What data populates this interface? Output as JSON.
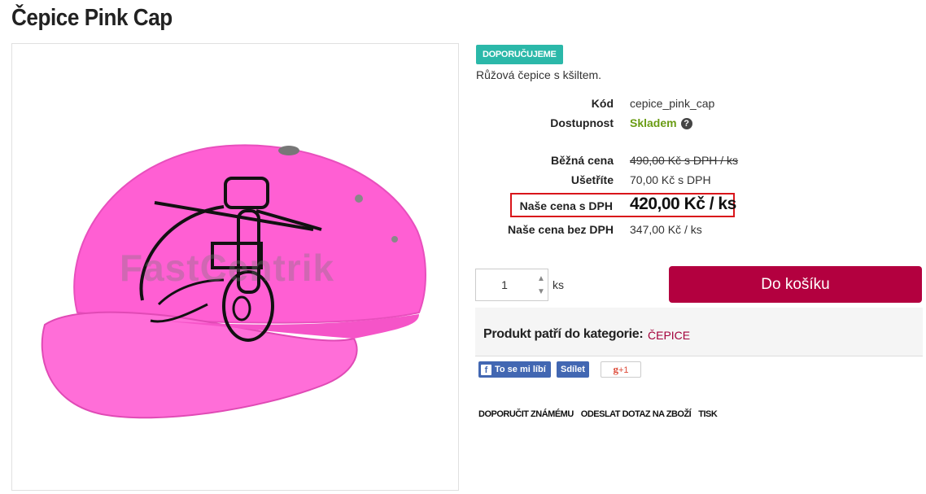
{
  "product": {
    "title": "Čepice Pink Cap",
    "badge": "DOPORUČUJEME",
    "short_description": "Růžová čepice s kšiltem.",
    "watermark": "FastCentrik",
    "image_icon": "pink-baseball-cap-image"
  },
  "details": {
    "code_label": "Kód",
    "code_value": "cepice_pink_cap",
    "availability_label": "Dostupnost",
    "availability_value": "Skladem",
    "availability_help_icon": "question-circle-icon",
    "regular_price_label": "Běžná cena",
    "regular_price_value": "490,00 Kč s DPH / ks",
    "savings_label": "Ušetříte",
    "savings_value": "70,00 Kč s DPH",
    "our_price_label": "Naše cena s DPH",
    "our_price_value": "420,00 Kč / ks",
    "price_no_vat_label": "Naše cena bez DPH",
    "price_no_vat_value": "347,00 Kč / ks"
  },
  "cart": {
    "quantity": "1",
    "unit": "ks",
    "up_arrow": "▲",
    "down_arrow": "▼",
    "button_label": "Do košíku"
  },
  "category": {
    "label": "Produkt patří do kategorie:",
    "link": "ČEPICE"
  },
  "social": {
    "like": "To se mi líbí",
    "share": "Sdílet",
    "gplus": "+1",
    "gplus_g": "g"
  },
  "actions": {
    "recommend": "DOPORUČIT ZNÁMÉMU",
    "ask": "ODESLAT DOTAZ NA ZBOŽÍ",
    "print": "TISK"
  },
  "colors": {
    "badge": "#2bb8a9",
    "cart_button": "#b3003f",
    "availability": "#6a9c14",
    "price_highlight_border": "#d9151b",
    "facebook": "#4267b2",
    "cap": "#ff5fd3"
  }
}
